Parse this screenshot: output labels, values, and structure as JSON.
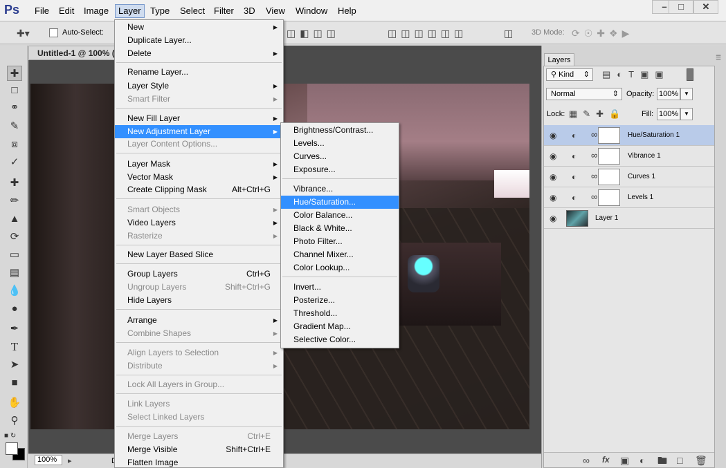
{
  "app": {
    "logo": "Ps"
  },
  "menubar": {
    "items": [
      "File",
      "Edit",
      "Image",
      "Layer",
      "Type",
      "Select",
      "Filter",
      "3D",
      "View",
      "Window",
      "Help"
    ],
    "window_controls": [
      "–",
      "□",
      "✕"
    ]
  },
  "options_bar": {
    "auto_select_label": "Auto-Select:",
    "mode_3d_label": "3D Mode:"
  },
  "document": {
    "tab_title": "Untitled-1 @ 100% (H",
    "zoom": "100%",
    "status_fragment": "D"
  },
  "layers_panel": {
    "tab_label": "Layers",
    "kind_label": "Kind",
    "blend_mode": "Normal",
    "opacity_label": "Opacity:",
    "opacity_value": "100%",
    "lock_label": "Lock:",
    "fill_label": "Fill:",
    "fill_value": "100%",
    "layers": [
      {
        "name": "Hue/Saturation 1",
        "type": "adjustment",
        "selected": true
      },
      {
        "name": "Vibrance 1",
        "type": "adjustment",
        "selected": false
      },
      {
        "name": "Curves 1",
        "type": "adjustment",
        "selected": false
      },
      {
        "name": "Levels 1",
        "type": "adjustment",
        "selected": false
      },
      {
        "name": "Layer 1",
        "type": "image",
        "selected": false
      }
    ],
    "footer_fx": "fx"
  },
  "layer_menu": {
    "items": [
      {
        "label": "New",
        "submenu": true
      },
      {
        "label": "Duplicate Layer...",
        "submenu": false
      },
      {
        "label": "Delete",
        "submenu": true
      },
      {
        "label": "Rename Layer...",
        "submenu": false
      },
      {
        "label": "Layer Style",
        "submenu": true
      },
      {
        "label": "Smart Filter",
        "submenu": true,
        "disabled": true
      },
      {
        "label": "New Fill Layer",
        "submenu": true
      },
      {
        "label": "New Adjustment Layer",
        "submenu": true,
        "highlighted": true
      },
      {
        "label": "Layer Content Options...",
        "disabled": true
      },
      {
        "label": "Layer Mask",
        "submenu": true
      },
      {
        "label": "Vector Mask",
        "submenu": true
      },
      {
        "label": "Create Clipping Mask",
        "shortcut": "Alt+Ctrl+G"
      },
      {
        "label": "Smart Objects",
        "submenu": true,
        "disabled": true
      },
      {
        "label": "Video Layers",
        "submenu": true
      },
      {
        "label": "Rasterize",
        "submenu": true,
        "disabled": true
      },
      {
        "label": "New Layer Based Slice"
      },
      {
        "label": "Group Layers",
        "shortcut": "Ctrl+G"
      },
      {
        "label": "Ungroup Layers",
        "shortcut": "Shift+Ctrl+G",
        "disabled": true
      },
      {
        "label": "Hide Layers"
      },
      {
        "label": "Arrange",
        "submenu": true
      },
      {
        "label": "Combine Shapes",
        "submenu": true,
        "disabled": true
      },
      {
        "label": "Align Layers to Selection",
        "submenu": true,
        "disabled": true
      },
      {
        "label": "Distribute",
        "submenu": true,
        "disabled": true
      },
      {
        "label": "Lock All Layers in Group...",
        "disabled": true
      },
      {
        "label": "Link Layers",
        "disabled": true
      },
      {
        "label": "Select Linked Layers",
        "disabled": true
      },
      {
        "label": "Merge Layers",
        "shortcut": "Ctrl+E",
        "disabled": true
      },
      {
        "label": "Merge Visible",
        "shortcut": "Shift+Ctrl+E"
      },
      {
        "label": "Flatten Image"
      }
    ]
  },
  "adjustment_submenu": {
    "items": [
      {
        "label": "Brightness/Contrast..."
      },
      {
        "label": "Levels..."
      },
      {
        "label": "Curves..."
      },
      {
        "label": "Exposure..."
      },
      {
        "label": "Vibrance..."
      },
      {
        "label": "Hue/Saturation...",
        "highlighted": true
      },
      {
        "label": "Color Balance..."
      },
      {
        "label": "Black & White..."
      },
      {
        "label": "Photo Filter..."
      },
      {
        "label": "Channel Mixer..."
      },
      {
        "label": "Color Lookup..."
      },
      {
        "label": "Invert..."
      },
      {
        "label": "Posterize..."
      },
      {
        "label": "Threshold..."
      },
      {
        "label": "Gradient Map..."
      },
      {
        "label": "Selective Color..."
      }
    ]
  },
  "colors": {
    "highlight": "#3390ff",
    "selected_layer": "#b9cbe9",
    "logo": "#2b3d8f"
  }
}
